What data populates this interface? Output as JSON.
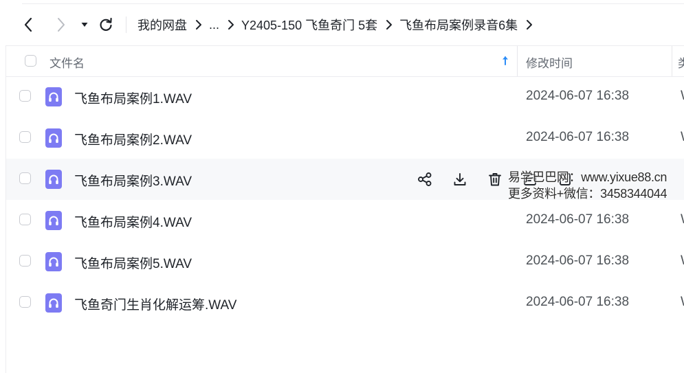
{
  "nav": {
    "back_icon": "chevron-left-icon",
    "forward_icon": "chevron-right-icon",
    "dropdown_icon": "caret-down-icon",
    "refresh_icon": "refresh-icon"
  },
  "breadcrumb": [
    {
      "label": "我的网盘"
    },
    {
      "label": "..."
    },
    {
      "label": "Y2405-150 飞鱼奇门 5套"
    },
    {
      "label": "飞鱼布局案例录音6集"
    }
  ],
  "table": {
    "columns": {
      "name": "文件名",
      "modified": "修改时间",
      "type": "类"
    },
    "sort_icon": "arrow-up-icon",
    "accent_color": "#2b8cf7",
    "file_icon_color": "#7d7bf3",
    "rows": [
      {
        "name": "飞鱼布局案例1.WAV",
        "modified": "2024-06-07 16:38",
        "type": "WAV"
      },
      {
        "name": "飞鱼布局案例2.WAV",
        "modified": "2024-06-07 16:38",
        "type": "WAV"
      },
      {
        "name": "飞鱼布局案例3.WAV",
        "modified": "",
        "type": ""
      },
      {
        "name": "飞鱼布局案例4.WAV",
        "modified": "2024-06-07 16:38",
        "type": "WAV"
      },
      {
        "name": "飞鱼布局案例5.WAV",
        "modified": "2024-06-07 16:38",
        "type": "WAV"
      },
      {
        "name": "飞鱼奇门生肖化解运筹.WAV",
        "modified": "2024-06-07 16:38",
        "type": "WAV"
      }
    ],
    "hover_actions": [
      "share-icon",
      "download-icon",
      "trash-icon",
      "rename-icon",
      "more-icon"
    ]
  },
  "watermark": {
    "line1": "易学巴巴网：www.yixue88.cn",
    "line2": "更多资料+微信：3458344044"
  }
}
